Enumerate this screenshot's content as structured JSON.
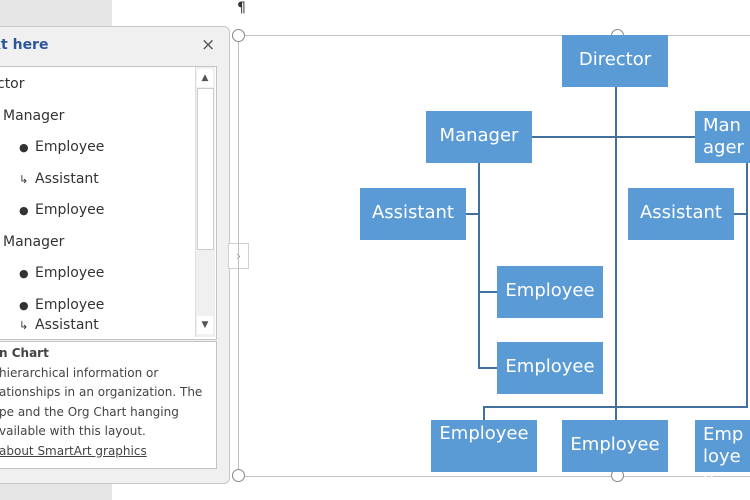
{
  "pilcrow": "¶",
  "text_pane": {
    "title": "Type your text here",
    "title_visible": "xt here",
    "close_icon": "×",
    "items": [
      {
        "text": "Director",
        "visible": "ctor"
      },
      {
        "text": "Manager"
      },
      {
        "text": "Employee"
      },
      {
        "text": "Assistant"
      },
      {
        "text": "Employee"
      },
      {
        "text": "Manager"
      },
      {
        "text": "Employee"
      },
      {
        "text": "Employee"
      },
      {
        "text": "Assistant"
      }
    ],
    "description": {
      "heading": "n Chart",
      "lines": [
        "hierarchical information or",
        "ationships in an organization. The",
        "pe and the Org Chart hanging",
        "vailable with this layout."
      ],
      "link": "about SmartArt graphics"
    },
    "expand_icon": "›"
  },
  "org_chart": {
    "director": "Director",
    "manager_left": "Manager",
    "manager_right": "Manager",
    "assistant_left": "Assistant",
    "assistant_right": "Assistant",
    "employee_1": "Employee",
    "employee_2": "Employee",
    "bottom_employees": [
      "Employee",
      "Employee",
      "Employee"
    ],
    "box_color": "#5b9bd5"
  }
}
